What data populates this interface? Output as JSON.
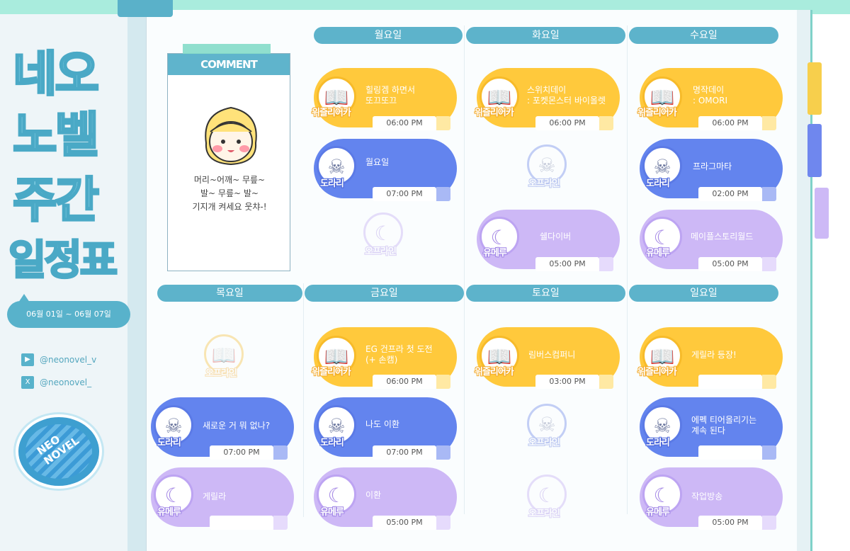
{
  "title": {
    "line1": "네오",
    "line2": "노벨",
    "line3": "주간",
    "line4": "일정표"
  },
  "dates": "06월 01일 ~ 06월 07일",
  "socials": [
    {
      "icon": "youtube-icon",
      "handle": "@neonovel_v"
    },
    {
      "icon": "x-icon",
      "handle": "@neonovel_"
    }
  ],
  "logo": {
    "line1": "NEO",
    "line2": "NOVEL"
  },
  "comment": {
    "heading": "COMMENT",
    "text1": "머리~어깨~ 무릎~",
    "text2": "발~ 무릎~ 발~",
    "text3": "기지개 켜세요 웃챠-!"
  },
  "days": {
    "mon": "월요일",
    "tue": "화요일",
    "wed": "수요일",
    "thu": "목요일",
    "fri": "금요일",
    "sat": "토요일",
    "sun": "일요일"
  },
  "labels": {
    "yellow": "위즐리어카",
    "blue": "도라리",
    "purple": "유메루",
    "offline": "오프라인"
  },
  "cards": {
    "mon1": {
      "title1": "힐링겜 하면서",
      "title2": "또끄또끄",
      "time": "06:00 PM"
    },
    "mon2": {
      "title1": "월요일",
      "title2": "",
      "time": "07:00 PM"
    },
    "tue1": {
      "title1": "스위치데이",
      "title2": ": 포켓몬스터 바이올렛",
      "time": "06:00 PM"
    },
    "tue3": {
      "title1": "쉘다이버",
      "title2": "",
      "time": "05:00 PM"
    },
    "wed1": {
      "title1": "명작데이",
      "title2": ": OMORI",
      "time": "06:00 PM"
    },
    "wed2": {
      "title1": "프라그마타",
      "title2": "",
      "time": "02:00 PM"
    },
    "wed3": {
      "title1": "메이플스토리월드",
      "title2": "",
      "time": "05:00 PM"
    },
    "thu2": {
      "title1": "새로운 거 뭐 없나?",
      "title2": "",
      "time": "07:00 PM"
    },
    "thu3": {
      "title1": "게릴라",
      "title2": "",
      "time": ""
    },
    "fri1": {
      "title1": "EG 건프라 첫 도전",
      "title2": "(+ 손캠)",
      "time": "06:00 PM"
    },
    "fri2": {
      "title1": "나도 이환",
      "title2": "",
      "time": "07:00 PM"
    },
    "fri3": {
      "title1": "이환",
      "title2": "",
      "time": "05:00 PM"
    },
    "sat1": {
      "title1": "림버스컴퍼니",
      "title2": "",
      "time": "03:00 PM"
    },
    "sun1": {
      "title1": "게릴라 등장!",
      "title2": "",
      "time": ""
    },
    "sun2": {
      "title1": "에펙 티어올리기는",
      "title2": "계속 된다",
      "time": ""
    },
    "sun3": {
      "title1": "작업방송",
      "title2": "",
      "time": "05:00 PM"
    }
  },
  "colors": {
    "yellow": "#ffc93c",
    "blue": "#6384ee",
    "purple": "#cdb8f6",
    "header": "#5db3cb"
  }
}
